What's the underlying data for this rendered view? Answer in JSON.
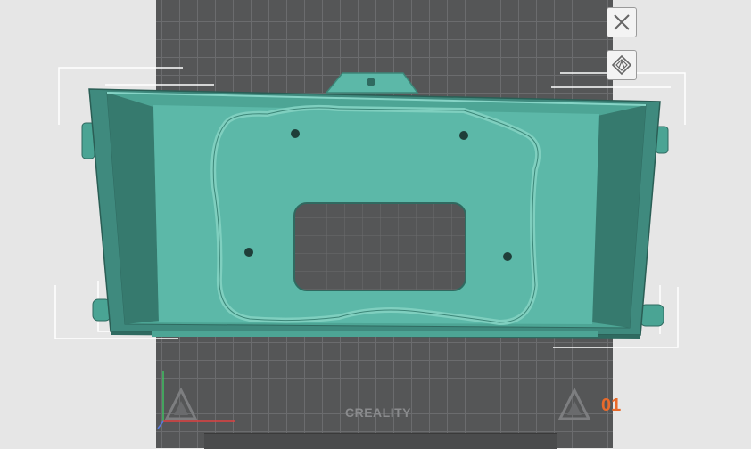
{
  "scene": {
    "bed_brand": "CREALITY",
    "plate_number": "01",
    "colors": {
      "background": "#e6e6e6",
      "bed": "#555657",
      "grid": "#6b6c6e",
      "model": "#5cb8a8",
      "model_dark": "#3c8678",
      "plate_label": "#e86a2b"
    }
  },
  "toolbar": {
    "buttons": [
      {
        "name": "close-view-button",
        "icon": "close-icon"
      },
      {
        "name": "auto-orient-button",
        "icon": "auto-arrange-icon"
      }
    ]
  }
}
